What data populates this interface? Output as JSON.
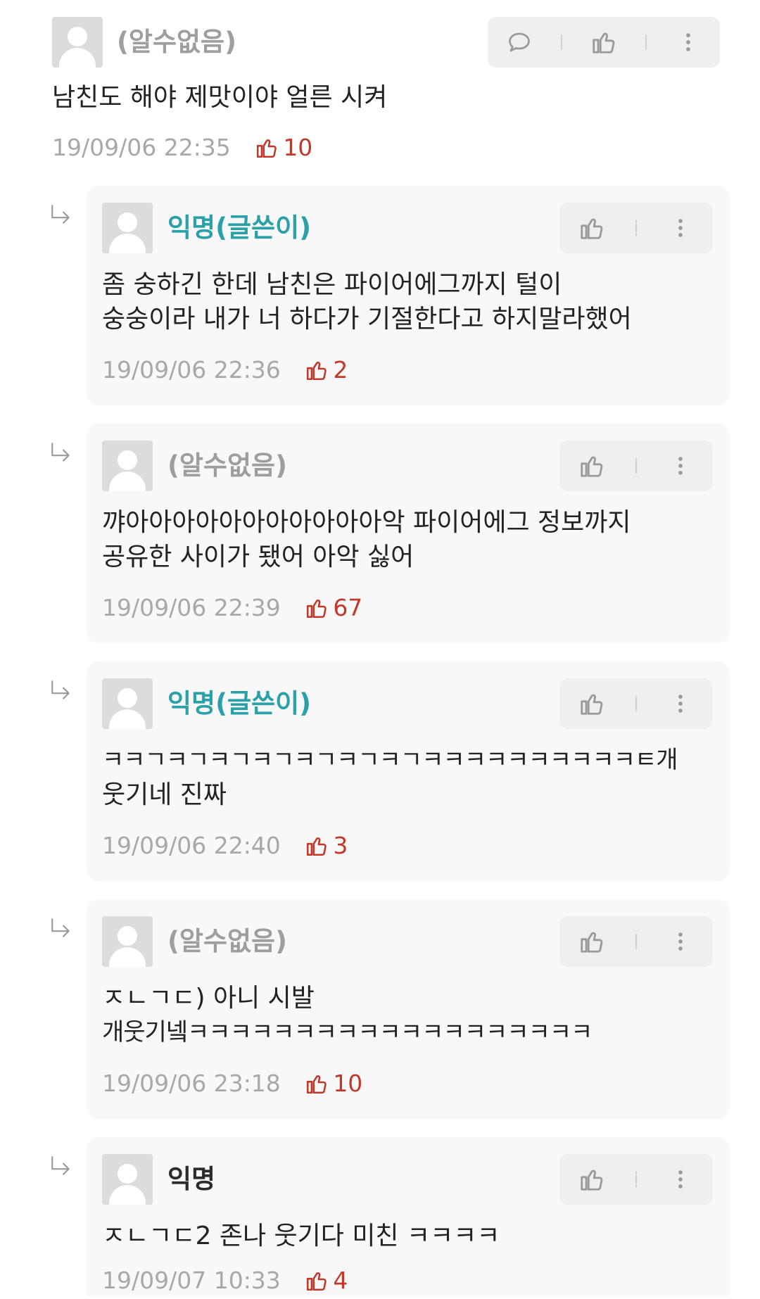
{
  "icons": {
    "reply": "reply-arrow-icon",
    "comment": "comment-icon",
    "thumb": "thumb-up-icon",
    "more": "more-vert-icon"
  },
  "colors": {
    "writer_name": "#2aa1a8",
    "unknown_name": "#9e9e9e",
    "like": "#c0392b",
    "date": "#a8a8a8"
  },
  "comments": [
    {
      "name": "(알수없음)",
      "lines": [
        "남친도 해야 제맛이야 얼른 시켜"
      ],
      "date": "19/09/06 22:35",
      "likes": "10"
    },
    {
      "name": "익명(글쓴이)",
      "lines": [
        "좀 숭하긴 한데 남친은 파이어에그까지 털이",
        "숭숭이라 내가 너 하다가 기절한다고 하지말라했어"
      ],
      "date": "19/09/06 22:36",
      "likes": "2"
    },
    {
      "name": "(알수없음)",
      "lines": [
        "꺄아아아아아아아아아아아악 파이어에그 정보까지",
        "공유한 사이가 됐어 아악 싫어"
      ],
      "date": "19/09/06 22:39",
      "likes": "67"
    },
    {
      "name": "익명(글쓴이)",
      "lines": [
        "ㅋㅋㄱㅋㄱㅋㄱㅋㄱㅋㄱㅋㄱㅋㄱㅋㅋㅋㅋㅋㅋㅋㅋㅋㅋㅌ개",
        "웃기네 진짜"
      ],
      "date": "19/09/06 22:40",
      "likes": "3"
    },
    {
      "name": "(알수없음)",
      "lines": [
        "ㅈㄴㄱㄷ) 아니 시발",
        "개웃기넼ㅋㅋㅋㅋㅋㅋㅋㅋㅋㅋㅋㅋㅋㅋㅋㅋㅋㅋㅋ"
      ],
      "date": "19/09/06 23:18",
      "likes": "10"
    },
    {
      "name": "익명",
      "lines": [
        "ㅈㄴㄱㄷ2 존나 웃기다 미친 ㅋㅋㅋㅋ"
      ],
      "date": "19/09/07 10:33",
      "likes": "4"
    }
  ]
}
